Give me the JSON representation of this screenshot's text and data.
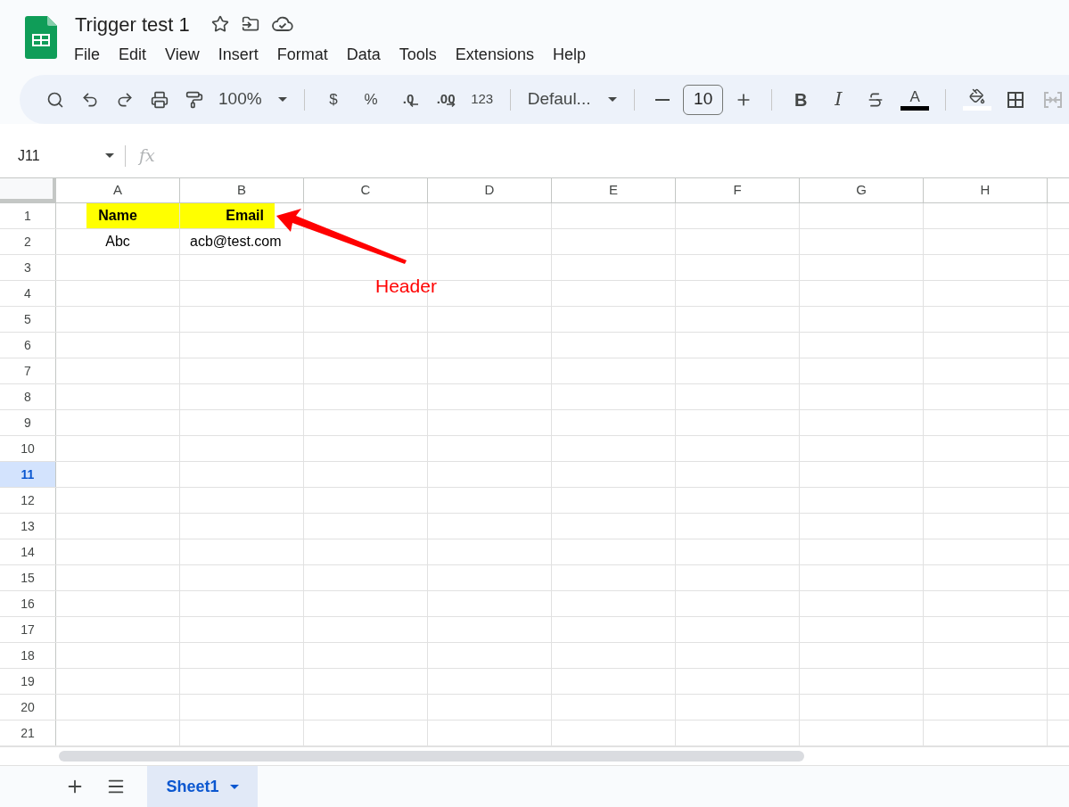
{
  "document": {
    "title": "Trigger test 1"
  },
  "menu": [
    {
      "label": "File"
    },
    {
      "label": "Edit"
    },
    {
      "label": "View"
    },
    {
      "label": "Insert"
    },
    {
      "label": "Format"
    },
    {
      "label": "Data"
    },
    {
      "label": "Tools"
    },
    {
      "label": "Extensions"
    },
    {
      "label": "Help"
    }
  ],
  "toolbar": {
    "zoom": "100%",
    "currency": "$",
    "percent": "%",
    "decrease_decimal": ".0",
    "increase_decimal": ".00",
    "number_format": "123",
    "font": "Defaul...",
    "font_size": "10",
    "bold": "B",
    "italic": "I",
    "text_color": "A"
  },
  "formula_bar": {
    "name_box": "J11",
    "fx": "fx"
  },
  "columns": [
    {
      "label": "A",
      "selected": false
    },
    {
      "label": "B",
      "selected": false
    },
    {
      "label": "C",
      "selected": false
    },
    {
      "label": "D",
      "selected": false
    },
    {
      "label": "E",
      "selected": false
    },
    {
      "label": "F",
      "selected": false
    },
    {
      "label": "G",
      "selected": false
    },
    {
      "label": "H",
      "selected": false
    }
  ],
  "rows": [
    {
      "label": "1",
      "selected": false,
      "cells": [
        {
          "text": "Name",
          "bold": true,
          "highlighted": true
        },
        {
          "text": "Email",
          "bold": true,
          "highlighted": true
        }
      ]
    },
    {
      "label": "2",
      "selected": false,
      "cells": [
        {
          "text": "Abc",
          "bold": false,
          "highlighted": false
        },
        {
          "text": "acb@test.com",
          "bold": false,
          "highlighted": false
        }
      ]
    },
    {
      "label": "3",
      "selected": false
    },
    {
      "label": "4",
      "selected": false
    },
    {
      "label": "5",
      "selected": false
    },
    {
      "label": "6",
      "selected": false
    },
    {
      "label": "7",
      "selected": false
    },
    {
      "label": "8",
      "selected": false
    },
    {
      "label": "9",
      "selected": false
    },
    {
      "label": "10",
      "selected": false
    },
    {
      "label": "11",
      "selected": true
    },
    {
      "label": "12",
      "selected": false
    },
    {
      "label": "13",
      "selected": false
    },
    {
      "label": "14",
      "selected": false
    },
    {
      "label": "15",
      "selected": false
    },
    {
      "label": "16",
      "selected": false
    },
    {
      "label": "17",
      "selected": false
    },
    {
      "label": "18",
      "selected": false
    },
    {
      "label": "19",
      "selected": false
    },
    {
      "label": "20",
      "selected": false
    },
    {
      "label": "21",
      "selected": false
    }
  ],
  "annotation": {
    "label": "Header"
  },
  "sheets": [
    {
      "label": "Sheet1",
      "selected": true
    }
  ]
}
